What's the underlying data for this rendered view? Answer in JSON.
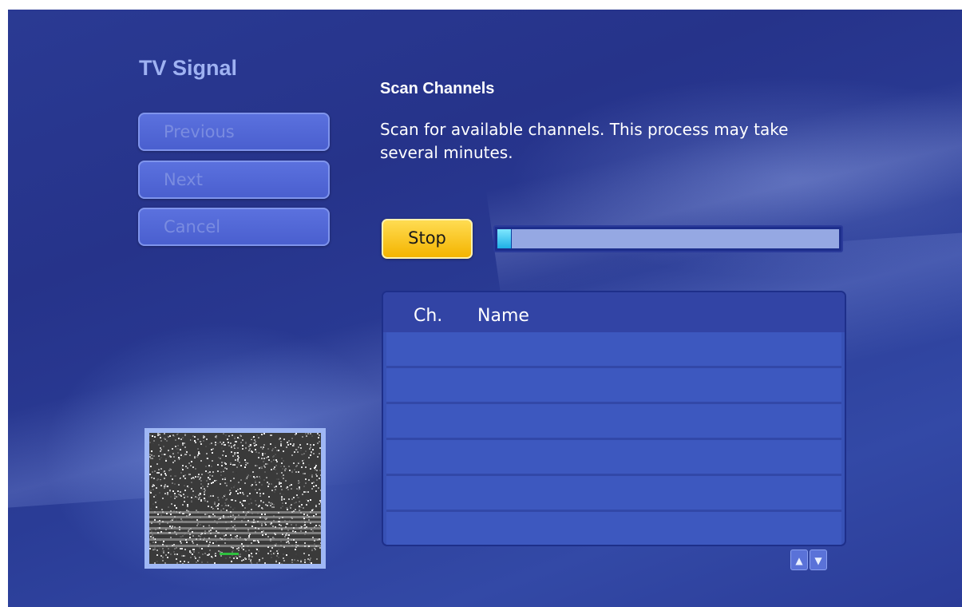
{
  "sidebar": {
    "title": "TV Signal",
    "buttons": [
      {
        "label": "Previous"
      },
      {
        "label": "Next"
      },
      {
        "label": "Cancel"
      }
    ]
  },
  "main": {
    "heading": "Scan Channels",
    "description": "Scan for available channels. This process may take several minutes.",
    "stop_label": "Stop",
    "progress": 0.04,
    "list": {
      "columns": {
        "channel": "Ch.",
        "name": "Name"
      },
      "rows": []
    }
  },
  "icons": {
    "scroll_up": "chevron-up-icon",
    "scroll_down": "chevron-down-icon"
  },
  "colors": {
    "background": "#2a3a93",
    "accent_button": "#ffc21a",
    "title_text": "#9fb2f2"
  }
}
